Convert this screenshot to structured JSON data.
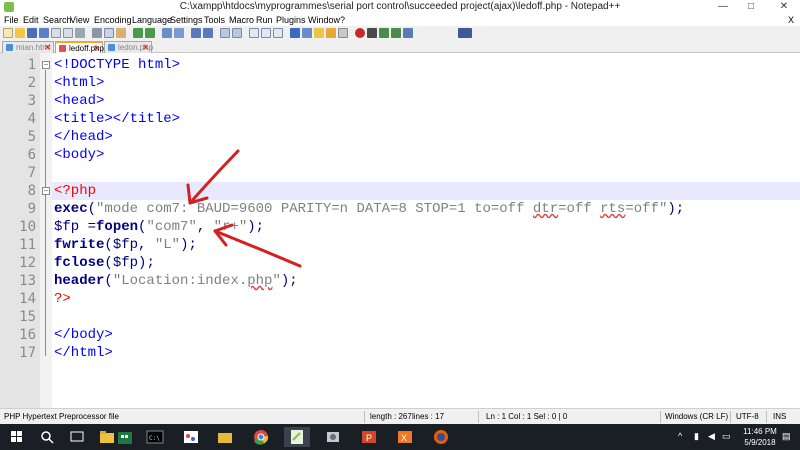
{
  "window": {
    "title": "C:\\xampp\\htdocs\\myprogrammes\\serial port control\\succeeded project(ajax)\\ledoff.php - Notepad++",
    "controls": [
      "—",
      "□",
      "✕"
    ]
  },
  "menu": [
    "File",
    "Edit",
    "Search",
    "View",
    "Encoding",
    "Language",
    "Settings",
    "Tools",
    "Macro",
    "Run",
    "Plugins",
    "Window",
    "?"
  ],
  "menu_close": "X",
  "toolbar": {
    "icons": [
      "new-file-icon",
      "open-file-icon",
      "save-icon",
      "save-all-icon",
      "close-icon",
      "close-all-icon",
      "print-icon",
      "cut-icon",
      "copy-icon",
      "paste-icon",
      "undo-icon",
      "redo-icon",
      "find-icon",
      "replace-icon",
      "zoom-in-icon",
      "zoom-out-icon",
      "sync-vertical-icon",
      "sync-horizontal-icon",
      "word-wrap-icon",
      "show-all-chars-icon",
      "indent-guide-icon",
      "lang-icon",
      "doc-map-icon",
      "function-list-icon",
      "folder-workspace-icon",
      "monitoring-icon",
      "record-macro-icon",
      "stop-record-icon",
      "play-macro-icon",
      "play-multiple-icon",
      "save-macro-icon",
      "spell-check-icon"
    ]
  },
  "tabs": [
    {
      "label": "mian.html",
      "active": false,
      "icon_color": "#4a90d9"
    },
    {
      "label": "ledoff.php",
      "active": true,
      "icon_color": "#e05050"
    },
    {
      "label": "ledon.php",
      "active": false,
      "icon_color": "#4a90d9"
    }
  ],
  "editor": {
    "current_line": 8,
    "lines": [
      {
        "n": "1",
        "tokens": [
          {
            "t": "<!DOCTYPE html>",
            "c": "tag"
          }
        ]
      },
      {
        "n": "2",
        "tokens": [
          {
            "t": "<html>",
            "c": "tag"
          }
        ]
      },
      {
        "n": "3",
        "tokens": [
          {
            "t": "<head>",
            "c": "tag"
          }
        ]
      },
      {
        "n": "4",
        "tokens": [
          {
            "t": "<title></title>",
            "c": "tag"
          }
        ]
      },
      {
        "n": "5",
        "tokens": [
          {
            "t": "</head>",
            "c": "tag"
          }
        ]
      },
      {
        "n": "6",
        "tokens": [
          {
            "t": "<body>",
            "c": "tag"
          }
        ]
      },
      {
        "n": "7",
        "tokens": []
      },
      {
        "n": "8",
        "tokens": [
          {
            "t": "<?php",
            "c": "php"
          }
        ]
      },
      {
        "n": "9",
        "tokens": [
          {
            "t": "exec",
            "c": "fn"
          },
          {
            "t": "(",
            "c": "op"
          },
          {
            "t": "\"mode com7: BAUD=9600 PARITY=n DATA=8 STOP=1 to=off ",
            "c": "str"
          },
          {
            "t": "dtr",
            "c": "str-sq"
          },
          {
            "t": "=off ",
            "c": "str"
          },
          {
            "t": "rts",
            "c": "str-sq"
          },
          {
            "t": "=off\"",
            "c": "str"
          },
          {
            "t": ");",
            "c": "op"
          }
        ]
      },
      {
        "n": "10",
        "tokens": [
          {
            "t": "$fp ",
            "c": "var"
          },
          {
            "t": "=",
            "c": "op"
          },
          {
            "t": "fopen",
            "c": "fn"
          },
          {
            "t": "(",
            "c": "op"
          },
          {
            "t": "\"com7\"",
            "c": "str"
          },
          {
            "t": ", ",
            "c": "op"
          },
          {
            "t": "\"r+\"",
            "c": "str"
          },
          {
            "t": ");",
            "c": "op"
          }
        ]
      },
      {
        "n": "11",
        "tokens": [
          {
            "t": "fwrite",
            "c": "fn"
          },
          {
            "t": "(",
            "c": "op"
          },
          {
            "t": "$fp",
            "c": "var"
          },
          {
            "t": ", ",
            "c": "op"
          },
          {
            "t": "\"L\"",
            "c": "str"
          },
          {
            "t": ");",
            "c": "op"
          }
        ]
      },
      {
        "n": "12",
        "tokens": [
          {
            "t": "fclose",
            "c": "fn"
          },
          {
            "t": "(",
            "c": "op"
          },
          {
            "t": "$fp",
            "c": "var"
          },
          {
            "t": ");",
            "c": "op"
          }
        ]
      },
      {
        "n": "13",
        "tokens": [
          {
            "t": "header",
            "c": "fn"
          },
          {
            "t": "(",
            "c": "op"
          },
          {
            "t": "\"Location:index.",
            "c": "str"
          },
          {
            "t": "php",
            "c": "str-sq"
          },
          {
            "t": "\"",
            "c": "str"
          },
          {
            "t": ");",
            "c": "op"
          }
        ]
      },
      {
        "n": "14",
        "tokens": [
          {
            "t": "?>",
            "c": "php"
          }
        ]
      },
      {
        "n": "15",
        "tokens": []
      },
      {
        "n": "16",
        "tokens": [
          {
            "t": "</body>",
            "c": "tag"
          }
        ]
      },
      {
        "n": "17",
        "tokens": [
          {
            "t": "</html>",
            "c": "tag"
          }
        ]
      }
    ]
  },
  "status": {
    "file_type": "PHP Hypertext Preprocessor file",
    "length": "length : 267",
    "lines": "lines : 17",
    "position": "Ln : 1    Col : 1    Sel : 0 | 0",
    "eol": "Windows (CR LF)",
    "encoding": "UTF-8",
    "mode": "INS"
  },
  "taskbar": {
    "apps": [
      "start-icon",
      "search-icon",
      "task-view-icon",
      "file-explorer-icon",
      "store-icon",
      "excel-icon",
      "cmd-icon",
      "paint-icon",
      "folder-icon",
      "chrome-icon",
      "notepadpp-icon",
      "tools-icon",
      "powerpoint-icon",
      "xampp-icon",
      "firefox-icon"
    ],
    "time": "11:46 PM",
    "date": "5/9/2018"
  },
  "colors": {
    "tag": "#0000ff",
    "php": "#ff0000",
    "function": "#000080",
    "string": "#808080",
    "current_line": "#e8e8ff",
    "arrow": "#d42020"
  }
}
